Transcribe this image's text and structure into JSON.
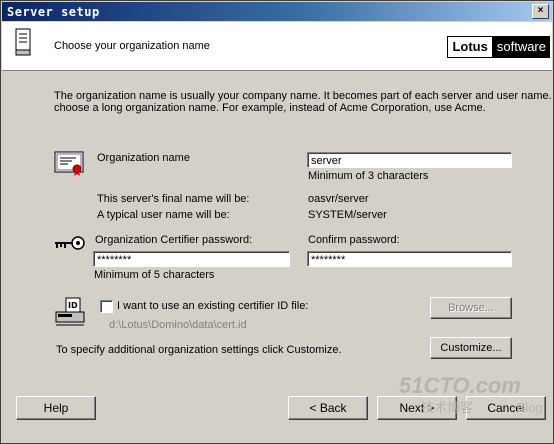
{
  "window": {
    "title": "Server setup",
    "close_label": "×"
  },
  "header": {
    "title": "Choose your organization name",
    "logo_brand": "Lotus",
    "logo_product": "software"
  },
  "intro": {
    "line1": "The organization name is usually your company name. It becomes part of each server and user name. Do not",
    "line2": "choose a long organization name. For example, instead of Acme Corporation, use Acme."
  },
  "org": {
    "label": "Organization name",
    "value": "server",
    "hint": "Minimum of 3 characters"
  },
  "final_names": {
    "server_label": "This server's final name will be:",
    "server_value": "oasvr/server",
    "user_label": "A typical user name will be:",
    "user_value": "SYSTEM/server"
  },
  "certifier": {
    "password_label": "Organization Certifier password:",
    "password_value": "********",
    "password_hint": "Minimum of 5 characters",
    "confirm_label": "Confirm password:",
    "confirm_value": "********"
  },
  "existing_id": {
    "checkbox_label": "I want to use an existing certifier ID file:",
    "checked": false,
    "path": "d:\\Lotus\\Domino\\data\\cert.id",
    "browse_label": "Browse..."
  },
  "customize": {
    "text": "To specify additional organization settings click Customize.",
    "button_label": "Customize..."
  },
  "footer": {
    "help_label": "Help",
    "back_label": "< Back",
    "next_label": "Next >",
    "cancel_label": "Cancel"
  },
  "watermark": {
    "line1": "51CTO.com",
    "line2": "技术博客",
    "line3": "Blog"
  },
  "colors": {
    "title_gradient_start": "#0a246a",
    "title_gradient_end": "#a6caf0",
    "dialog_bg": "#d4d0c8"
  },
  "icons": [
    "document-icon",
    "certificate-icon",
    "key-icon",
    "id-card-icon"
  ]
}
